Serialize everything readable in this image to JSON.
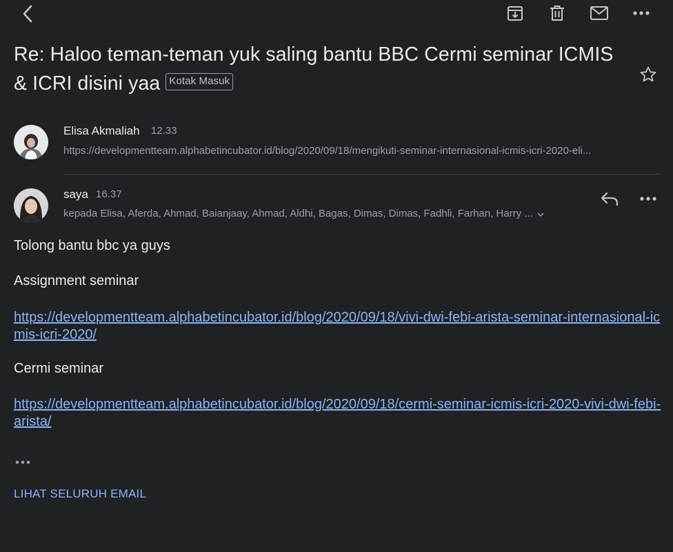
{
  "toolbar": {
    "back_icon": "chevron-left-icon",
    "archive_icon": "archive-icon",
    "delete_icon": "trash-icon",
    "mark_unread_icon": "envelope-icon",
    "more_icon": "more-horizontal-icon"
  },
  "thread": {
    "subject": "Re: Haloo teman-teman yuk saling bantu BBC Cermi seminar ICMIS & ICRI disini yaa",
    "label": "Kotak Masuk"
  },
  "messages": [
    {
      "sender": "Elisa Akmaliah",
      "time": "12.33",
      "snippet": "https://developmentteam.alphabetincubator.id/blog/2020/09/18/mengikuti-seminar-internasional-icmis-icri-2020-eli..."
    },
    {
      "sender": "saya",
      "time": "16.37",
      "recipients": "kepada Elisa, Aferda, Ahmad, Baianjaay, Ahmad, Aldhi, Bagas, Dimas, Dimas, Fadhli, Farhan, Harry ...",
      "body": {
        "line1": "Tolong bantu bbc ya guys",
        "heading1": "Assignment seminar",
        "link1": "https://developmentteam.alphabetincubator.id/blog/2020/09/18/vivi-dwi-febi-arista-seminar-internasional-icmis-icri-2020/",
        "heading2": "Cermi seminar",
        "link2": "https://developmentteam.alphabetincubator.id/blog/2020/09/18/cermi-seminar-icmis-icri-2020-vivi-dwi-febi-arista/"
      }
    }
  ],
  "actions": {
    "view_all": "LIHAT SELURUH EMAIL"
  },
  "colors": {
    "background": "#202124",
    "text": "#e8eaed",
    "secondary": "#9aa0a6",
    "link": "#8ab4f8"
  }
}
